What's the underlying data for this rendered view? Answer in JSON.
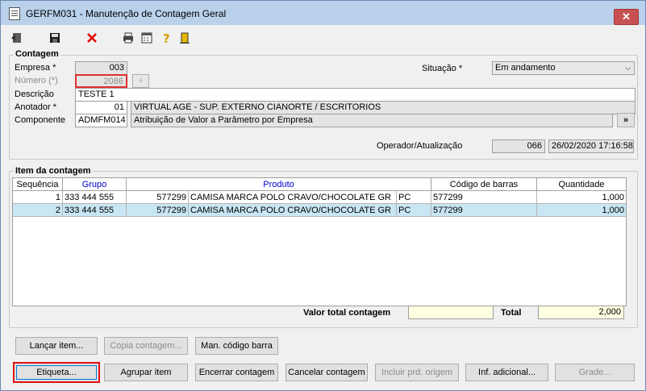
{
  "window": {
    "title": "GERFM031 - Manutenção de Contagem Geral",
    "close_label": "✕"
  },
  "toolbar": {
    "icons": [
      "exit-icon",
      "save-icon",
      "delete-icon",
      "print-icon",
      "calculator-icon",
      "help-icon",
      "door-icon"
    ]
  },
  "contagem": {
    "legend": "Contagem",
    "empresa": {
      "label": "Empresa *",
      "value": "003"
    },
    "numero": {
      "label": "Número (*)",
      "value": "2086"
    },
    "descricao": {
      "label": "Descrição",
      "value": "TESTE 1"
    },
    "anotador": {
      "label": "Anotador *",
      "code": "01",
      "name": "VIRTUAL AGE - SUP. EXTERNO CIANORTE / ESCRITORIOS"
    },
    "componente": {
      "label": "Componente",
      "code": "ADMFM014",
      "name": "Atribuição de Valor a Parâmetro por Empresa",
      "button": "»"
    },
    "situacao": {
      "label": "Situação *",
      "value": "Em andamento"
    },
    "operador": {
      "label": "Operador/Atualização",
      "code": "066",
      "datetime": "26/02/2020 17:16:58"
    }
  },
  "items": {
    "legend": "Item da contagem",
    "columns": [
      "Sequência",
      "Grupo",
      "Produto",
      "Código de barras",
      "Quantidade"
    ],
    "rows": [
      {
        "seq": "1",
        "grupo": "333 444 555",
        "cod": "577299",
        "produto": "CAMISA MARCA POLO CRAVO/CHOCOLATE GR",
        "un": "PC",
        "barras": "577299",
        "qtd": "1,000"
      },
      {
        "seq": "2",
        "grupo": "333 444 555",
        "cod": "577299",
        "produto": "CAMISA MARCA POLO CRAVO/CHOCOLATE GR",
        "un": "PC",
        "barras": "577299",
        "qtd": "1,000"
      }
    ],
    "valor_total_label": "Valor total contagem",
    "valor_total": "",
    "total_label": "Total",
    "total": "2,000"
  },
  "buttons": {
    "lancar": "Lançar item...",
    "copia": "Copia contagem...",
    "man_codigo": "Man. código barra",
    "etiqueta": "Etiqueta...",
    "agrupar": "Agrupar item",
    "encerrar": "Encerrar contagem",
    "cancelar": "Cancelar contagem",
    "incluir": "Incluir prd. origem",
    "inf_adicional": "Inf. adicional...",
    "grade": "Grade..."
  }
}
